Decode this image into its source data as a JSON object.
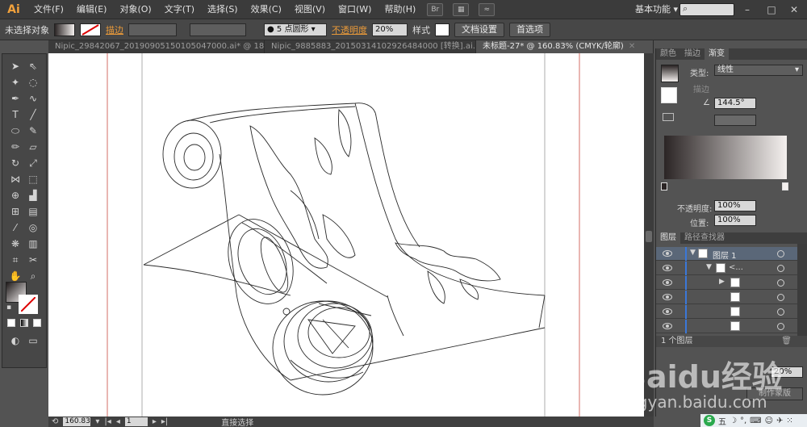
{
  "app": {
    "logo": "Ai",
    "menu": [
      "文件(F)",
      "编辑(E)",
      "对象(O)",
      "文字(T)",
      "选择(S)",
      "效果(C)",
      "视图(V)",
      "窗口(W)",
      "帮助(H)"
    ],
    "bridge_label": "Br",
    "workspace": "基本功能",
    "search_placeholder": ""
  },
  "control_bar": {
    "selection_state": "未选择对象",
    "stroke_label": "描边",
    "brush_value": "5 点圆形",
    "opacity_label": "不透明度",
    "opacity_value": "20%",
    "style_label": "样式",
    "doc_setup_button": "文档设置",
    "preferences_button": "首选项"
  },
  "tabs": [
    {
      "label": "Nipic_29842067_20190905150105047000.ai* @ 18..."
    },
    {
      "label": "Nipic_9885883_20150314102926484000 [转换].ai..."
    },
    {
      "label": "未标题-27* @ 160.83% (CMYK/轮廓)"
    }
  ],
  "status_bar": {
    "zoom": "160.83",
    "artboard": "1",
    "tool_status": "直接选择"
  },
  "gradient_panel": {
    "tabs": [
      "颜色",
      "描边",
      "渐变"
    ],
    "type_label": "类型:",
    "type_value": "线性",
    "stroke_label": "描边",
    "angle_value": "144.5°",
    "opacity_label": "不透明度:",
    "opacity_value": "100%",
    "position_label": "位置:",
    "position_value": "100%",
    "ramp_start": "#2b2525",
    "ramp_end": "#f4f0ee"
  },
  "layers_panel": {
    "tabs": [
      "图层",
      "路径查找器"
    ],
    "layer_name": "图层 1",
    "sublayer_name": "<...",
    "footer": "1 个图层"
  },
  "bottom_panel": {
    "field_value": "20%",
    "button_label": "制作蒙版"
  },
  "watermark": {
    "line1": "Baidu经验",
    "line2": "jingyan.baidu.com"
  },
  "tray": {
    "ime": "五"
  },
  "colors": {
    "accent_orange": "#e99a3a",
    "selection_blue": "#3b78d8",
    "guide_red": "#d9534f"
  }
}
